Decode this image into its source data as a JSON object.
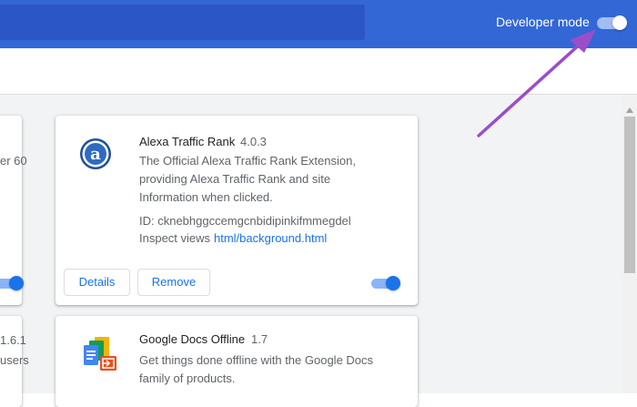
{
  "header": {
    "developer_mode_label": "Developer mode",
    "developer_mode_on": true
  },
  "left_peek": {
    "card1_text": "er 60",
    "card2_line1": "1.6.1",
    "card2_line2": "users"
  },
  "extensions": [
    {
      "name": "Alexa Traffic Rank",
      "version": "4.0.3",
      "description": "The Official Alexa Traffic Rank Extension, providing Alexa Traffic Rank and site Information when clicked.",
      "id_label": "ID: cknebhggccemgcnbidipinkifmmegdel",
      "inspect_label": "Inspect views",
      "inspect_link": "html/background.html",
      "details_label": "Details",
      "remove_label": "Remove",
      "enabled": true,
      "icon": "alexa-icon"
    },
    {
      "name": "Google Docs Offline",
      "version": "1.7",
      "description": "Get things done offline with the Google Docs family of products.",
      "icon": "google-docs-offline-icon"
    }
  ],
  "colors": {
    "header": "#3367d6",
    "accent": "#1a73e8",
    "annotation_arrow": "#9b4dca"
  }
}
